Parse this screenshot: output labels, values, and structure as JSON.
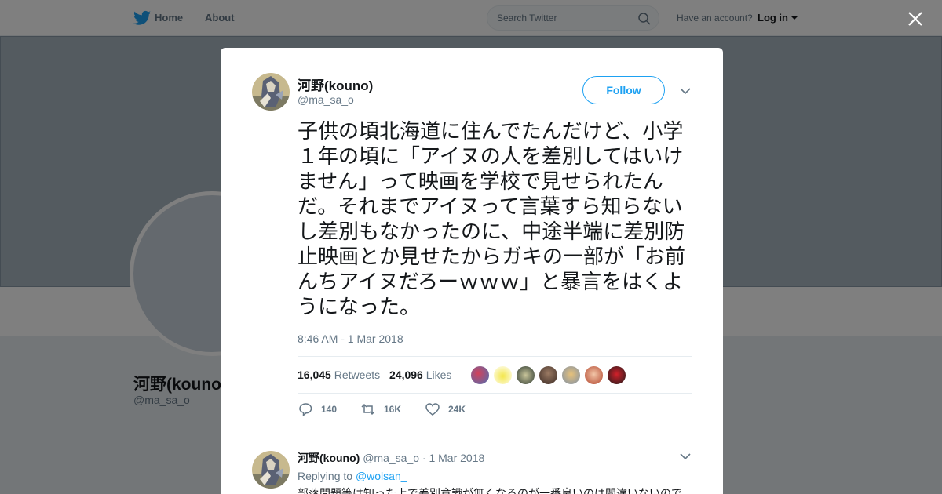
{
  "nav": {
    "home_label": "Home",
    "about_label": "About",
    "search_placeholder": "Search Twitter",
    "account_text": "Have an account?",
    "login_label": "Log in"
  },
  "profile": {
    "name": "河野(kouno)",
    "handle": "@ma_sa_o"
  },
  "tweet": {
    "author_name": "河野(kouno)",
    "author_handle": "@ma_sa_o",
    "follow_label": "Follow",
    "text": "子供の頃北海道に住んでたんだけど、小学１年の頃に「アイヌの人を差別してはいけません」って映画を学校で見せられたんだ。それまでアイヌって言葉すら知らないし差別もなかったのに、中途半端に差別防止映画とか見せたからガキの一部が「お前んちアイヌだろーｗｗｗ」と暴言をはくようになった。",
    "timestamp": "8:46 AM - 1 Mar 2018",
    "retweets_count": "16,045",
    "retweets_label": "Retweets",
    "likes_count": "24,096",
    "likes_label": "Likes",
    "actions": {
      "reply_count": "140",
      "retweet_count": "16K",
      "like_count": "24K"
    }
  },
  "reply": {
    "name": "河野(kouno)",
    "handle": "@ma_sa_o",
    "date": "· 1 Mar 2018",
    "replying_label": "Replying to",
    "replying_to": "@wolsan_",
    "text": "部落問題等は知った上で差別意識が無くなるのが一番良いのは間違いないので"
  },
  "colors": {
    "twitter_blue": "#1da1f2",
    "text_primary": "#14171a",
    "text_secondary": "#657786",
    "border": "#e6ecf0"
  },
  "icons": [
    "twitter-bird-icon",
    "search-icon",
    "close-icon",
    "chevron-down-icon",
    "reply-icon",
    "retweet-icon",
    "heart-icon"
  ]
}
